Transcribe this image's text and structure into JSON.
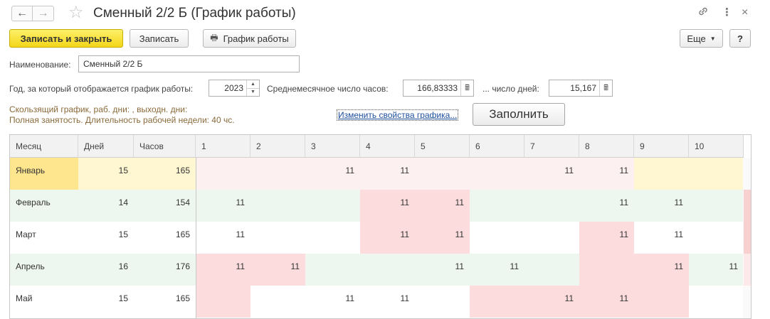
{
  "window": {
    "title": "Сменный 2/2 Б (График работы)",
    "icons": {
      "back": "arrow-left-icon",
      "forward": "arrow-right-icon",
      "favorite": "star-icon",
      "link": "link-icon",
      "menu": "more-vertical-icon",
      "close": "close-icon"
    }
  },
  "toolbar": {
    "save_close": "Записать и закрыть",
    "save": "Записать",
    "schedule": "График работы",
    "more": "Еще",
    "help": "?"
  },
  "form": {
    "name_label": "Наименование:",
    "name_value": "Сменный 2/2 Б",
    "year_label": "Год, за который отображается график работы:",
    "year_value": "2023",
    "avg_hours_label": "Среднемесячное число часов:",
    "avg_hours_value": "166,83333",
    "days_label": "... число дней:",
    "days_value": "15,167",
    "info_line1": "Скользящий график, раб. дни: , выходн. дни:",
    "info_line2": "Полная занятость. Длительность рабочей недели: 40 чс.",
    "change_link": "Изменить свойства графика...",
    "fill_button": "Заполнить"
  },
  "table": {
    "headers": [
      "Месяц",
      "Дней",
      "Часов",
      "1",
      "2",
      "3",
      "4",
      "5",
      "6",
      "7",
      "8",
      "9",
      "10"
    ],
    "rows": [
      {
        "month": "Январь",
        "days": "15",
        "hours": "165",
        "cells": [
          "",
          "",
          "11",
          "11",
          "",
          "",
          "11",
          "11",
          "",
          ""
        ]
      },
      {
        "month": "Февраль",
        "days": "14",
        "hours": "154",
        "cells": [
          "11",
          "",
          "",
          "11",
          "11",
          "",
          "",
          "11",
          "11",
          ""
        ]
      },
      {
        "month": "Март",
        "days": "15",
        "hours": "165",
        "cells": [
          "11",
          "",
          "",
          "11",
          "11",
          "",
          "",
          "11",
          "11",
          ""
        ]
      },
      {
        "month": "Апрель",
        "days": "16",
        "hours": "176",
        "cells": [
          "11",
          "11",
          "",
          "",
          "11",
          "11",
          "",
          "",
          "11",
          "11"
        ]
      },
      {
        "month": "Май",
        "days": "15",
        "hours": "165",
        "cells": [
          "",
          "",
          "11",
          "11",
          "",
          "",
          "11",
          "11",
          "",
          ""
        ]
      }
    ],
    "colors": {
      "header_bg": "#f2f2f2",
      "selected_month": "#fde68e",
      "selected_row": "#fff7d1",
      "holiday_cell": "#fcdcdc",
      "holiday_light": "#fdf0f0",
      "workday": "#eef7ef",
      "plain": "#ffffff"
    }
  }
}
